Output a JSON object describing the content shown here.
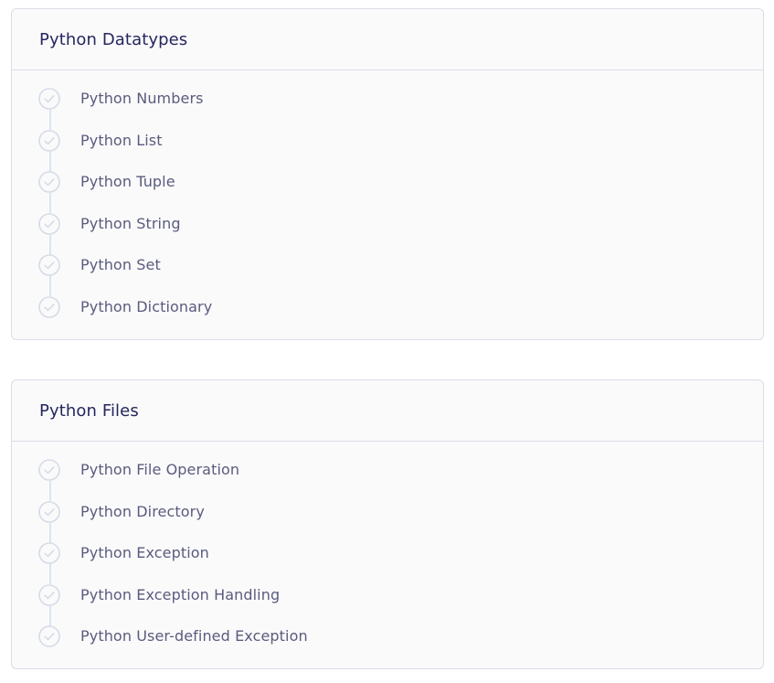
{
  "sections": [
    {
      "title": "Python Datatypes",
      "items": [
        {
          "label": "Python Numbers"
        },
        {
          "label": "Python List"
        },
        {
          "label": "Python Tuple"
        },
        {
          "label": "Python String"
        },
        {
          "label": "Python Set"
        },
        {
          "label": "Python Dictionary"
        }
      ]
    },
    {
      "title": "Python Files",
      "items": [
        {
          "label": "Python File Operation"
        },
        {
          "label": "Python Directory"
        },
        {
          "label": "Python Exception"
        },
        {
          "label": "Python Exception Handling"
        },
        {
          "label": "Python User-defined Exception"
        }
      ]
    }
  ],
  "colors": {
    "title": "#25265e",
    "label": "#5a5b7d",
    "check": "#d5dbe7",
    "line": "#dde3ee",
    "border": "#dadde6",
    "card_bg": "#fafafb"
  },
  "icons": {
    "step": "check-circle-icon"
  }
}
